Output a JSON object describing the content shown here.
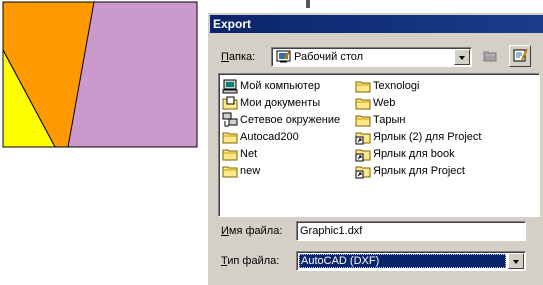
{
  "drawing": {
    "colors": {
      "orange": "#ff9900",
      "purple": "#cc99cc",
      "yellow": "#ffff00",
      "outline": "#000000"
    }
  },
  "dialog": {
    "title": "Export",
    "folder_label_hotkey": "П",
    "folder_label_rest": "апка:",
    "folder_value": "Рабочий стол",
    "items": [
      {
        "label": "Мой компьютер",
        "icon": "my-computer-icon"
      },
      {
        "label": "Мои документы",
        "icon": "my-documents-icon"
      },
      {
        "label": "Сетевое окружение",
        "icon": "network-icon"
      },
      {
        "label": "Autocad200",
        "icon": "folder-icon"
      },
      {
        "label": "Net",
        "icon": "folder-icon"
      },
      {
        "label": "new",
        "icon": "folder-icon"
      },
      {
        "label": "Texnologi",
        "icon": "folder-icon"
      },
      {
        "label": "Web",
        "icon": "folder-icon"
      },
      {
        "label": "Тарын",
        "icon": "folder-icon"
      },
      {
        "label": "Ярлык (2) для Project",
        "icon": "shortcut-icon"
      },
      {
        "label": "Ярлык для book",
        "icon": "shortcut-icon"
      },
      {
        "label": "Ярлык для Project",
        "icon": "shortcut-icon"
      }
    ],
    "filename_label_hotkey": "И",
    "filename_label_rest": "мя файла:",
    "filename_value": "Graphic1.dxf",
    "filetype_label_hotkey": "Т",
    "filetype_label_rest": "ип файла:",
    "filetype_value": "AutoCAD (DXF)"
  }
}
